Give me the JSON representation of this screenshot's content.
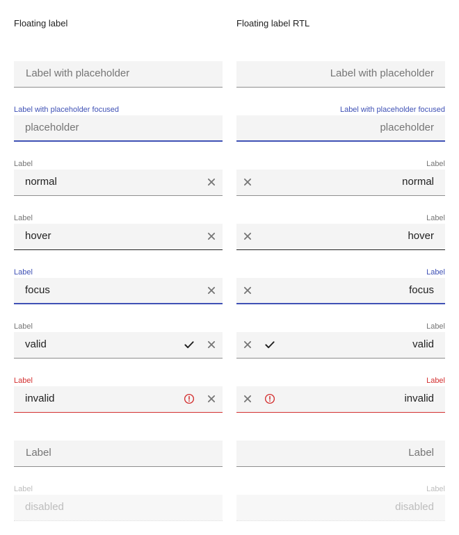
{
  "headings": {
    "ltr": "Floating label",
    "rtl": "Floating label RTL"
  },
  "fields": {
    "placeholder": {
      "value": "Label with placeholder"
    },
    "placeholder_focused": {
      "label": "Label with placeholder focused",
      "value": "placeholder"
    },
    "normal": {
      "label": "Label",
      "value": "normal",
      "icons": [
        "clear-icon"
      ]
    },
    "hover": {
      "label": "Label",
      "value": "hover",
      "icons": [
        "clear-icon"
      ]
    },
    "focus": {
      "label": "Label",
      "value": "focus",
      "icons": [
        "clear-icon"
      ]
    },
    "valid": {
      "label": "Label",
      "value": "valid",
      "icons": [
        "check-icon",
        "clear-icon"
      ]
    },
    "invalid": {
      "label": "Label",
      "value": "invalid",
      "icons": [
        "error-icon",
        "clear-icon"
      ]
    },
    "empty": {
      "value": "Label"
    },
    "disabled": {
      "label": "Label",
      "value": "disabled"
    }
  },
  "colors": {
    "focus": "#3f51b5",
    "error": "#d32f2f",
    "text": "#212121",
    "muted": "#757575",
    "disabled": "#bdbdbd",
    "field_bg": "#f4f4f4"
  }
}
